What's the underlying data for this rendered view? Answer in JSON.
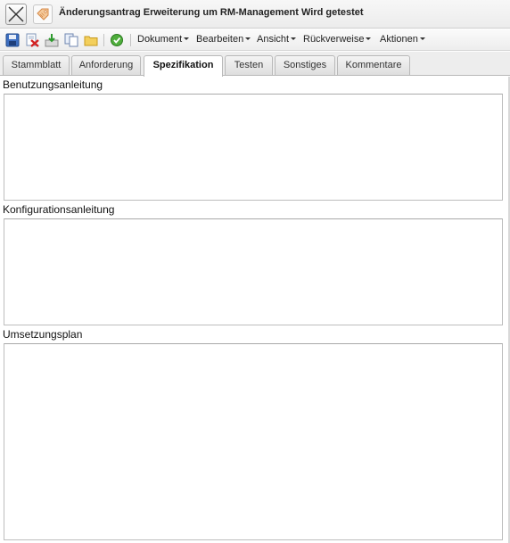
{
  "window": {
    "title": "Änderungsantrag Erweiterung um RM-Management Wird getestet"
  },
  "toolbar": {
    "icons": [
      "save-icon",
      "delete-icon",
      "export-icon",
      "copy-icon",
      "folder-icon",
      "refresh-icon"
    ],
    "menus": [
      "Dokument",
      "Bearbeiten",
      "Ansicht",
      "Rückverweise",
      "Aktionen"
    ]
  },
  "tabs": [
    {
      "label": "Stammblatt",
      "active": false
    },
    {
      "label": "Anforderung",
      "active": false
    },
    {
      "label": "Spezifikation",
      "active": true
    },
    {
      "label": "Testen",
      "active": false
    },
    {
      "label": "Sonstiges",
      "active": false
    },
    {
      "label": "Kommentare",
      "active": false
    }
  ],
  "sections": [
    {
      "label": "Benutzungsanleitung",
      "value": ""
    },
    {
      "label": "Konfigurationsanleitung",
      "value": ""
    },
    {
      "label": "Umsetzungsplan",
      "value": ""
    }
  ]
}
